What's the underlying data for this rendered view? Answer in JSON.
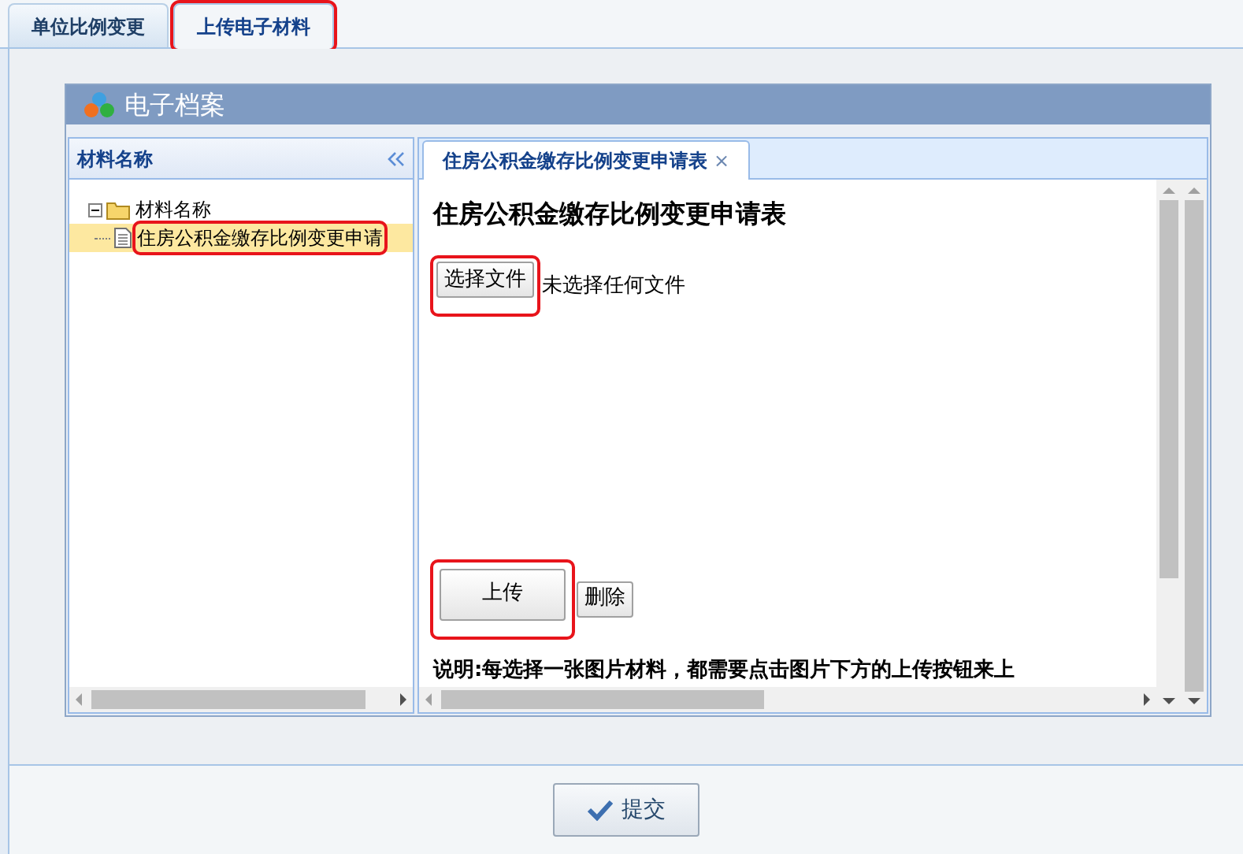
{
  "top_tabs": [
    {
      "label": "单位比例变更",
      "selected": false,
      "highlighted": false
    },
    {
      "label": "上传电子材料",
      "selected": true,
      "highlighted": true
    }
  ],
  "panel": {
    "title": "电子档案"
  },
  "tree": {
    "title": "材料名称",
    "items": [
      {
        "label": "材料名称",
        "expanded": true,
        "children": [
          {
            "label": "住房公积金缴存比例变更申请",
            "selected": true,
            "highlighted": true
          }
        ]
      }
    ]
  },
  "doc_tabs": [
    {
      "label": "住房公积金缴存比例变更申请表",
      "close": "×",
      "selected": true
    }
  ],
  "form": {
    "heading": "住房公积金缴存比例变更申请表",
    "file_button": {
      "label": "选择文件",
      "highlighted": true
    },
    "file_status": "未选择任何文件",
    "upload_button": {
      "label": "上传",
      "highlighted": true
    },
    "delete_button": "删除",
    "note": "说明:每选择一张图片材料，都需要点击图片下方的上传按钮来上"
  },
  "submit": {
    "label": "提交"
  }
}
